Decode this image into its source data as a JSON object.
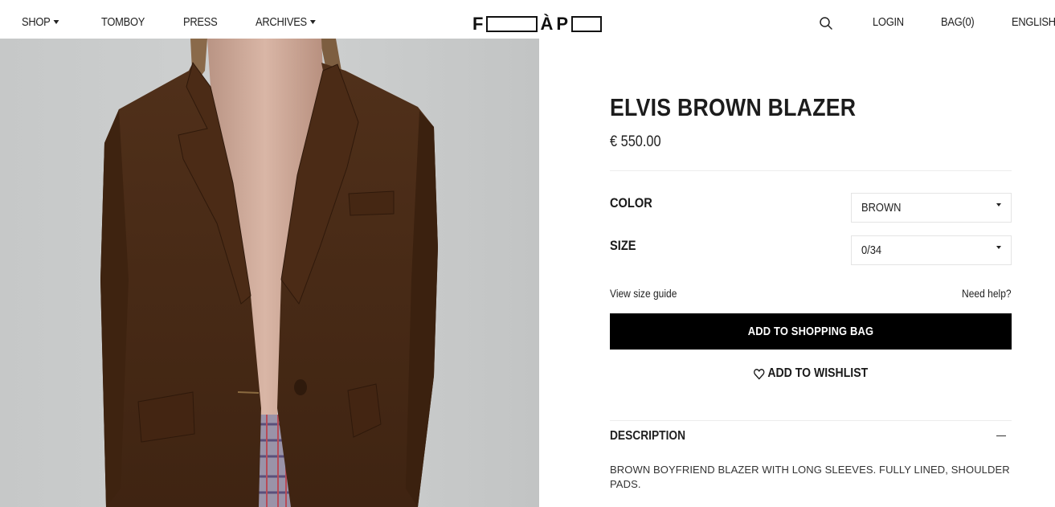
{
  "nav": {
    "shop": "SHOP",
    "tomboy": "TOMBOY",
    "press": "PRESS",
    "archives": "ARCHIVES",
    "login": "LOGIN",
    "bag": "BAG(0)",
    "language": "ENGLISH",
    "search_icon": "search-icon"
  },
  "logo": {
    "letter_1": "F",
    "letter_2": "À",
    "letter_3": "P"
  },
  "product": {
    "title": "ELVIS BROWN BLAZER",
    "price": "€ 550.00",
    "color_label": "COLOR",
    "color_value": "BROWN",
    "size_label": "SIZE",
    "size_value": "0/34",
    "size_guide_link": "View size guide",
    "help_link": "Need help?",
    "add_to_bag": "ADD TO SHOPPING BAG",
    "add_to_wishlist": "ADD TO WISHLIST",
    "wishlist_icon": "heart-icon",
    "description_heading": "DESCRIPTION",
    "description_toggle_icon": "minus-icon",
    "description_text": "BROWN BOYFRIEND BLAZER WITH LONG SLEEVES. FULLY LINED, SHOULDER PADS."
  },
  "colors": {
    "button_bg": "#000000",
    "button_text": "#ffffff",
    "blazer": "#4a2a17",
    "background_wall": "#c9cbcb"
  }
}
